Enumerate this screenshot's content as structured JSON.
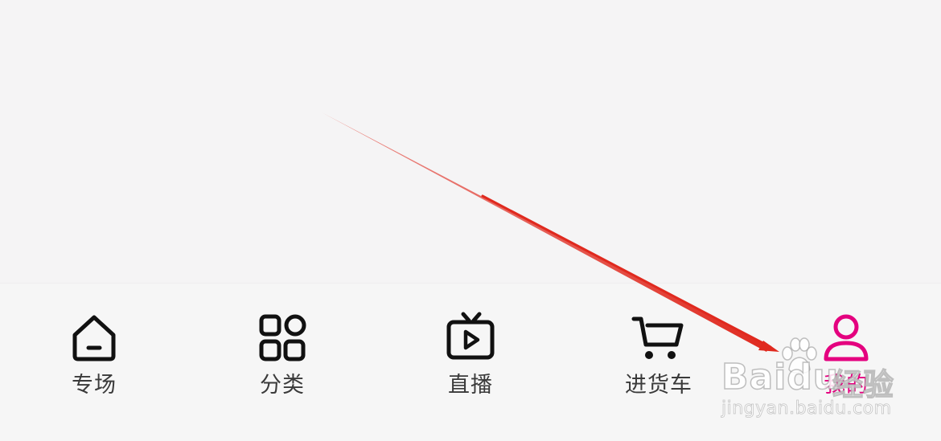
{
  "colors": {
    "accent": "#e4007f",
    "icon": "#111111",
    "label": "#3a3a3a",
    "arrow": "#e0291e"
  },
  "tabs": [
    {
      "id": "zhuanchang",
      "label": "专场",
      "icon": "home-icon",
      "active": false
    },
    {
      "id": "fenlei",
      "label": "分类",
      "icon": "grid-icon",
      "active": false
    },
    {
      "id": "zhibo",
      "label": "直播",
      "icon": "tv-play-icon",
      "active": false
    },
    {
      "id": "jinhuoche",
      "label": "进货车",
      "icon": "cart-icon",
      "active": false
    },
    {
      "id": "wode",
      "label": "我的",
      "icon": "user-icon",
      "active": true
    }
  ],
  "watermark": {
    "brand": "Baidu",
    "brand_cn": "经验",
    "url": "jingyan.baidu.com"
  }
}
